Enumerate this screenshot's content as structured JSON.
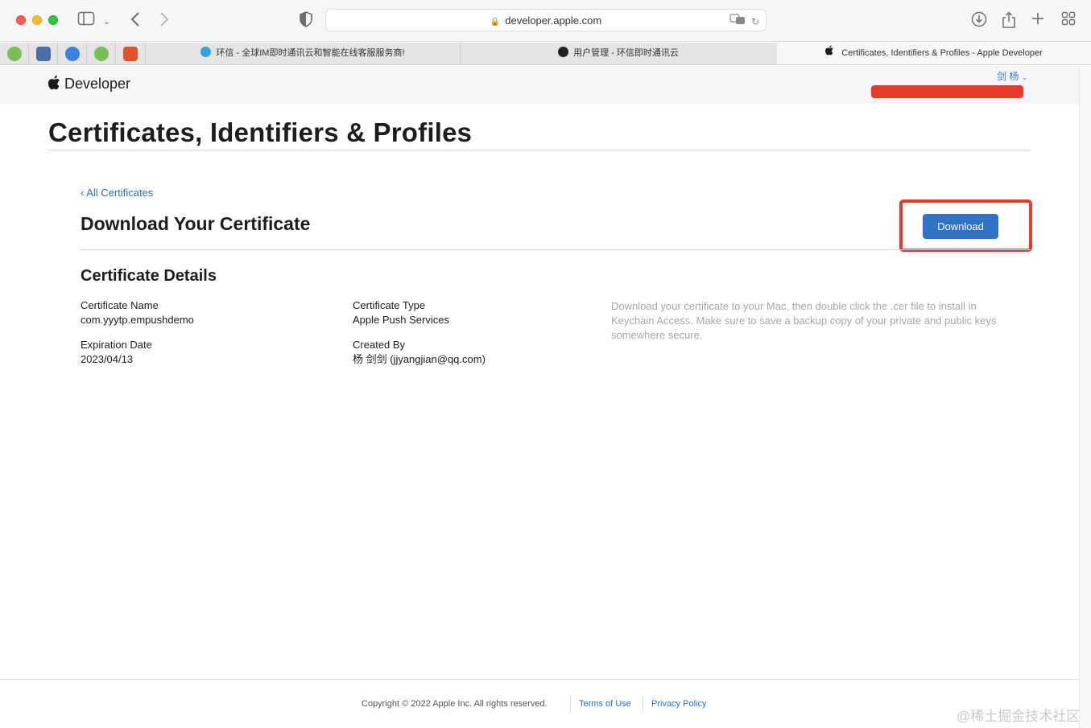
{
  "browser": {
    "url": "developer.apple.com",
    "tabs": [
      {
        "label": "环信 - 全球IM即时通讯云和智能在线客服服务商!",
        "active": false
      },
      {
        "label": "用户管理 - 环信即时通讯云",
        "active": false
      },
      {
        "label": "Certificates, Identifiers & Profiles - Apple Developer",
        "active": true
      }
    ]
  },
  "header": {
    "logo_text": "Developer",
    "user_name": "剑 杨"
  },
  "page": {
    "title": "Certificates, Identifiers & Profiles",
    "back_link": "‹ All Certificates",
    "section_title": "Download Your Certificate",
    "download_label": "Download",
    "details_title": "Certificate Details",
    "fields": {
      "name_label": "Certificate Name",
      "name_value": "com.yyytp.empushdemo",
      "type_label": "Certificate Type",
      "type_value": "Apple Push Services",
      "expiry_label": "Expiration Date",
      "expiry_value": "2023/04/13",
      "creator_label": "Created By",
      "creator_value": "杨 剑剑 (jjyangjian@qq.com)"
    },
    "note": "Download your certificate to your Mac, then double click the .cer file to install in Keychain Access. Make sure to save a backup copy of your private and public keys somewhere secure."
  },
  "footer": {
    "copyright": "Copyright © 2022 Apple Inc. All rights reserved.",
    "terms": "Terms of Use",
    "privacy": "Privacy Policy"
  },
  "watermark": "@稀土掘金技术社区",
  "colors": {
    "accent": "#2f72c8",
    "link": "#2c6fc5",
    "annotation": "#e8392b"
  }
}
